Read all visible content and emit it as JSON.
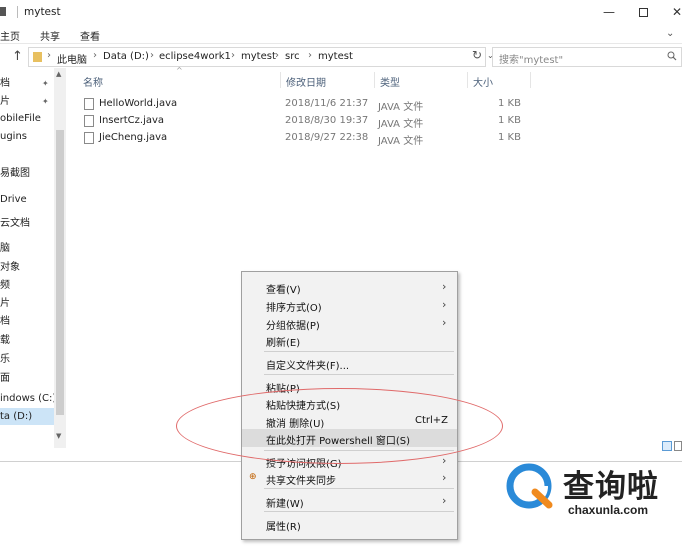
{
  "window": {
    "title": "mytest",
    "minimize_glyph": "—",
    "close_glyph": "✕"
  },
  "ribbon": {
    "tabs": [
      "主页",
      "共享",
      "查看"
    ],
    "expand_glyph": "⌄"
  },
  "address": {
    "back_glyph": "↑",
    "crumbs": [
      "此电脑",
      "Data (D:)",
      "eclipse4work1",
      "mytest",
      "src",
      "mytest"
    ],
    "crumb_sep": "›",
    "dropdown_glyph": "⌄",
    "refresh_glyph": "↻",
    "search_placeholder": "搜索\"mytest\""
  },
  "nav": {
    "items": [
      {
        "label": "档",
        "pinned": true
      },
      {
        "label": "片",
        "pinned": true
      },
      {
        "label": "obileFile",
        "pinned": false
      },
      {
        "label": "ugins",
        "pinned": false
      },
      {
        "label": "易截图",
        "pinned": false
      },
      {
        "label": "Drive",
        "pinned": false
      },
      {
        "label": "云文档",
        "pinned": false
      },
      {
        "label": "脑",
        "pinned": false
      },
      {
        "label": "对象",
        "pinned": false
      },
      {
        "label": "频",
        "pinned": false
      },
      {
        "label": "片",
        "pinned": false
      },
      {
        "label": "档",
        "pinned": false
      },
      {
        "label": "载",
        "pinned": false
      },
      {
        "label": "乐",
        "pinned": false
      },
      {
        "label": "面",
        "pinned": false
      },
      {
        "label": "indows (C:)",
        "pinned": false
      },
      {
        "label": "ta (D:)",
        "pinned": false,
        "selected": true
      }
    ],
    "pin_glyph": "📌"
  },
  "columns": {
    "name": "名称",
    "date": "修改日期",
    "type": "类型",
    "size": "大小",
    "sort_glyph": "^"
  },
  "files": [
    {
      "name": "HelloWorld.java",
      "date": "2018/11/6 21:37",
      "type": "JAVA 文件",
      "size": "1 KB"
    },
    {
      "name": "InsertCz.java",
      "date": "2018/8/30 19:37",
      "type": "JAVA 文件",
      "size": "1 KB"
    },
    {
      "name": "JieCheng.java",
      "date": "2018/9/27 22:38",
      "type": "JAVA 文件",
      "size": "1 KB"
    }
  ],
  "context_menu": {
    "items": [
      {
        "label": "查看(V)",
        "submenu": true
      },
      {
        "label": "排序方式(O)",
        "submenu": true
      },
      {
        "label": "分组依据(P)",
        "submenu": true
      },
      {
        "label": "刷新(E)",
        "submenu": false
      },
      {
        "label": "自定义文件夹(F)...",
        "submenu": false
      },
      {
        "label": "粘贴(P)",
        "submenu": false
      },
      {
        "label": "粘贴快捷方式(S)",
        "submenu": false
      },
      {
        "label": "撤消 删除(U)",
        "submenu": false,
        "shortcut": "Ctrl+Z"
      },
      {
        "label": "在此处打开 Powershell 窗口(S)",
        "submenu": false,
        "highlighted": true
      },
      {
        "label": "授予访问权限(G)",
        "submenu": true
      },
      {
        "label": "共享文件夹同步",
        "submenu": true,
        "icon": "sync-icon"
      },
      {
        "label": "新建(W)",
        "submenu": true
      },
      {
        "label": "属性(R)",
        "submenu": false
      }
    ],
    "arrow_glyph": "›",
    "sync_glyph": "⊕"
  },
  "colors": {
    "annotation_ellipse": "#e06a6a",
    "selection": "#cce4f7",
    "logo_blue": "#2a8ad8",
    "logo_orange": "#f08a1e"
  },
  "logo": {
    "cn": "查询啦",
    "en": "chaxunla.com"
  }
}
